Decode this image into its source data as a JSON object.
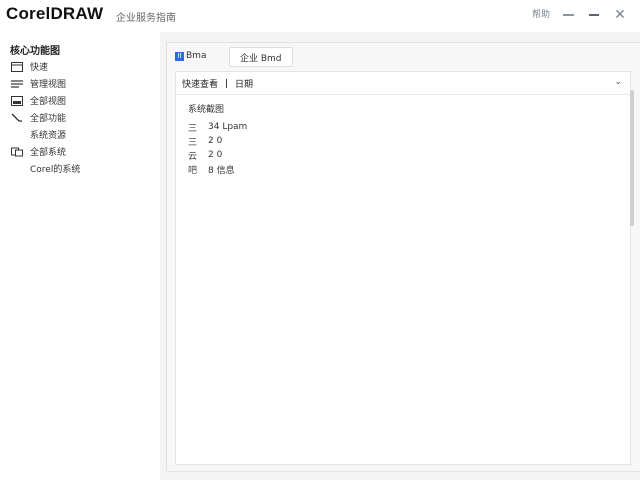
{
  "titlebar": {
    "app_title": "CorelDRAW",
    "caption": "企业服务指南",
    "help_label": "帮助",
    "icons": {
      "minimize": "minimize-icon",
      "maximize": "maximize-icon",
      "close": "close-icon"
    }
  },
  "sidebar": {
    "heading": "核心功能图",
    "items": [
      {
        "label": "快速",
        "icon": "layout-icon"
      },
      {
        "label": "管理视图",
        "icon": "list-icon"
      },
      {
        "label": "全部视图",
        "icon": "image-icon"
      },
      {
        "label": "全部功能",
        "icon": "pen-icon"
      },
      {
        "label": "系统资源",
        "icon": ""
      },
      {
        "label": "全部系统",
        "icon": "stack-icon"
      },
      {
        "label": "Corel的系统",
        "icon": ""
      }
    ]
  },
  "content": {
    "tabs": [
      {
        "badge": "II",
        "label": "Bma"
      },
      {
        "label": "企业 Bmd"
      }
    ],
    "dropdown": {
      "left": "快速查看",
      "right": "日期"
    },
    "info": {
      "title": "系统截图",
      "rows": [
        {
          "icon": "三",
          "text": "34 Lpam"
        },
        {
          "icon": "三",
          "text": "2 0"
        },
        {
          "icon": "云",
          "text": "2 0"
        },
        {
          "icon": "吧",
          "text": "8 信息"
        }
      ]
    }
  }
}
